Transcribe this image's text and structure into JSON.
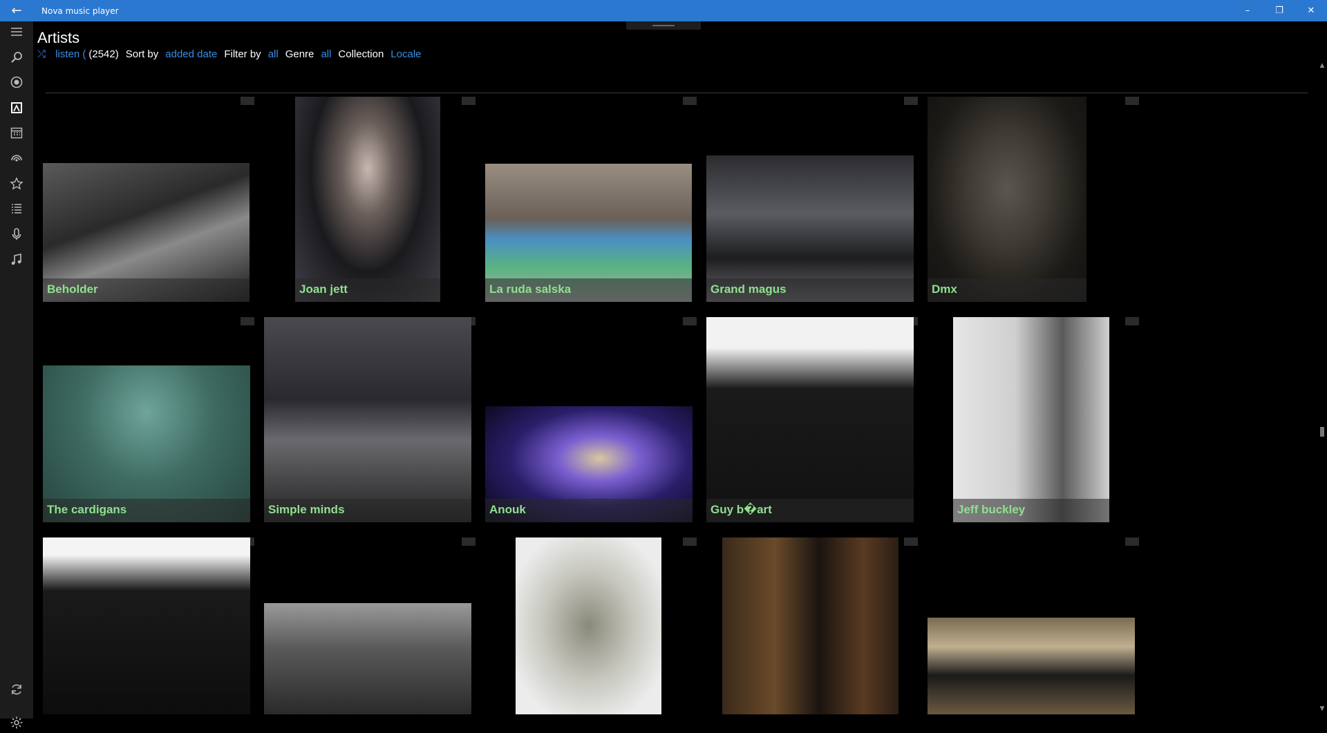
{
  "window": {
    "title": "Nova music player",
    "back_icon": "arrow-left-icon",
    "controls": {
      "minimize": "–",
      "restore": "❐",
      "close": "✕"
    }
  },
  "sidebar": {
    "items": [
      {
        "name": "menu-icon"
      },
      {
        "name": "search-icon"
      },
      {
        "name": "now-playing-icon"
      },
      {
        "name": "artists-icon",
        "active": true
      },
      {
        "name": "calendar-icon"
      },
      {
        "name": "podcast-icon"
      },
      {
        "name": "favorites-icon"
      },
      {
        "name": "playlist-icon"
      },
      {
        "name": "microphone-icon"
      },
      {
        "name": "music-library-icon"
      }
    ],
    "bottom": [
      {
        "name": "sync-icon"
      },
      {
        "name": "settings-icon"
      }
    ]
  },
  "header": {
    "title": "Artists",
    "shuffle_icon": "shuffle-icon",
    "listen_label": "listen (",
    "count": "(2542)",
    "sort_by_label": "Sort by",
    "sort_value": "added date",
    "filter_by_label": "Filter by",
    "filter_value": "all",
    "genre_label": "Genre",
    "genre_value": "all",
    "collection_label": "Collection",
    "collection_value": "Locale"
  },
  "artists": [
    {
      "name": "Beholder"
    },
    {
      "name": "Joan jett"
    },
    {
      "name": "La ruda salska"
    },
    {
      "name": "Grand magus"
    },
    {
      "name": "Dmx"
    },
    {
      "name": "The cardigans"
    },
    {
      "name": "Simple minds"
    },
    {
      "name": "Anouk"
    },
    {
      "name": "Guy b�art"
    },
    {
      "name": "Jeff buckley"
    },
    {
      "name": ""
    },
    {
      "name": ""
    },
    {
      "name": ""
    },
    {
      "name": ""
    },
    {
      "name": ""
    }
  ],
  "colors": {
    "titlebar": "#2b78d0",
    "accent": "#3b8de2",
    "artist_label": "#8fe08f",
    "sidebar": "#1c1c1c",
    "background": "#000000"
  }
}
